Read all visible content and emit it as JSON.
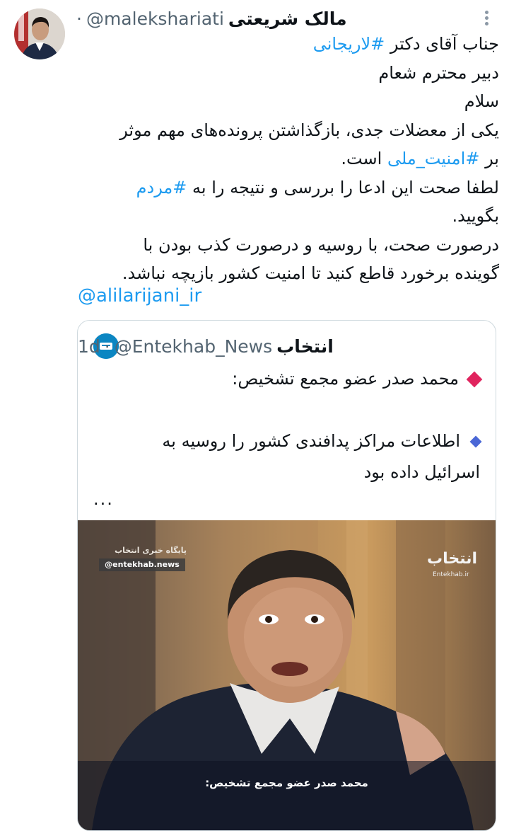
{
  "author": {
    "name": "مالک شریعتی",
    "handle": "@malekshariati",
    "separator": "·"
  },
  "icons": {
    "more": "more-vertical-icon",
    "quote_bullet_1": "red-diamond-icon",
    "quote_bullet_2": "blue-diamond-icon"
  },
  "colors": {
    "link": "#1d9bf0",
    "text": "#0f1419",
    "muted": "#536471"
  },
  "tweet": {
    "line1_a": "جناب آقای دکتر ",
    "line1_tag": "#لاریجانی",
    "line2": "دبیر محترم شعام",
    "line3": "سلام",
    "line4": "یکی از معضلات جدی، بازگذاشتن پرونده‌های مهم موثر",
    "line5_a": "بر ",
    "line5_tag": "#امنیت_ملی",
    "line5_b": " است.",
    "line6_a": "لطفا صحت این ادعا را بررسی و نتیجه را به ",
    "line6_tag": "#مردم",
    "line7": "بگویید.",
    "line8": "درصورت صحت، با روسیه و درصورت کذب بودن با",
    "line9": "گوینده برخورد قاطع کنید تا امنیت کشور بازیچه نباشد.",
    "mention": "@alilarijani_ir"
  },
  "quote": {
    "name": "انتخاب",
    "handle": "@Entekhab_News",
    "separator": "·",
    "age": "1d",
    "line1": "محمد صدر عضو مجمع تشخیص:",
    "line2": "اطلاعات مراکز پدافندی کشور را روسیه به",
    "line3": "اسرائیل داده بود",
    "ellipsis": "...",
    "image": {
      "watermark_top": "پایگاه خبری انتخاب",
      "watermark_handle": "@entekhab.news",
      "logo": "انتخاب",
      "site": "Entekhab.ir",
      "caption": "محمد صدر عضو مجمع تشخیص:"
    }
  }
}
